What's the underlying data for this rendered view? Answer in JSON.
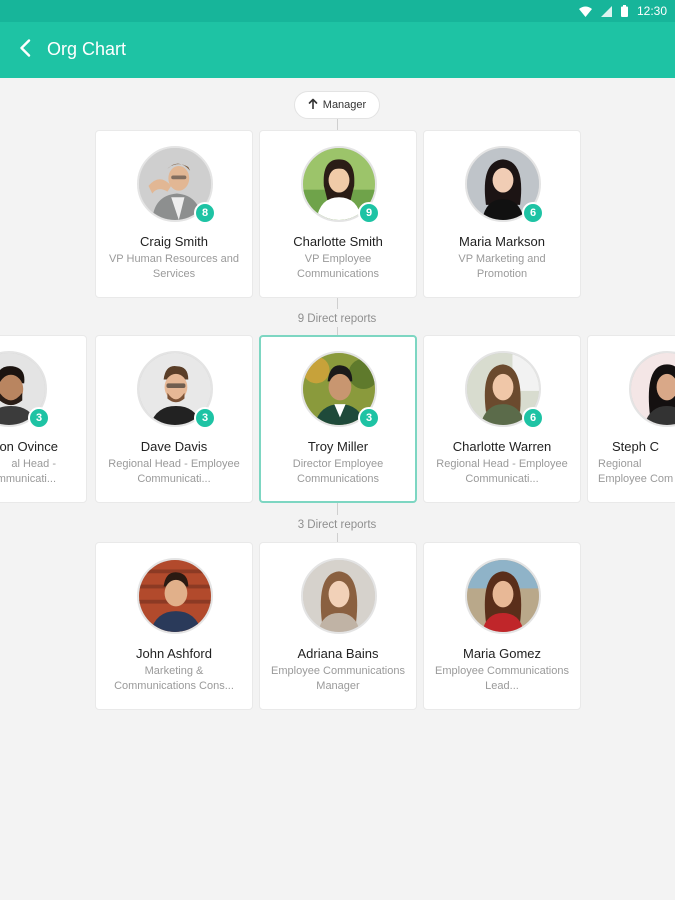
{
  "status_bar": {
    "time": "12:30"
  },
  "app_bar": {
    "title": "Org Chart"
  },
  "manager_chip": {
    "label": "Manager"
  },
  "managers": [
    {
      "name": "Craig Smith",
      "title": "VP Human Resources and Services",
      "reports": "8"
    },
    {
      "name": "Charlotte Smith",
      "title": "VP Employee Communications",
      "reports": "9"
    },
    {
      "name": "Maria Markson",
      "title": "VP Marketing and Promotion",
      "reports": "6"
    }
  ],
  "peers_label": "9 Direct reports",
  "peers": [
    {
      "name": "on Ovince",
      "title": "al Head - Communicati...",
      "reports": "3"
    },
    {
      "name": "Dave Davis",
      "title": "Regional Head - Employee Communicati...",
      "reports": "3"
    },
    {
      "name": "Troy Miller",
      "title": "Director Employee Communications",
      "reports": "3"
    },
    {
      "name": "Charlotte Warren",
      "title": "Regional Head - Employee Communicati...",
      "reports": "6"
    },
    {
      "name": "Steph C",
      "title": "Regional Employee Com",
      "reports": ""
    }
  ],
  "reports_label": "3 Direct reports",
  "reports": [
    {
      "name": "John Ashford",
      "title": "Marketing & Communications Cons..."
    },
    {
      "name": "Adriana Bains",
      "title": "Employee Communications Manager"
    },
    {
      "name": "Maria Gomez",
      "title": "Employee Communications Lead..."
    }
  ],
  "colors": {
    "accent": "#1ec3a4",
    "status_bar": "#17b59a",
    "selected_border": "#7dd6c2"
  }
}
